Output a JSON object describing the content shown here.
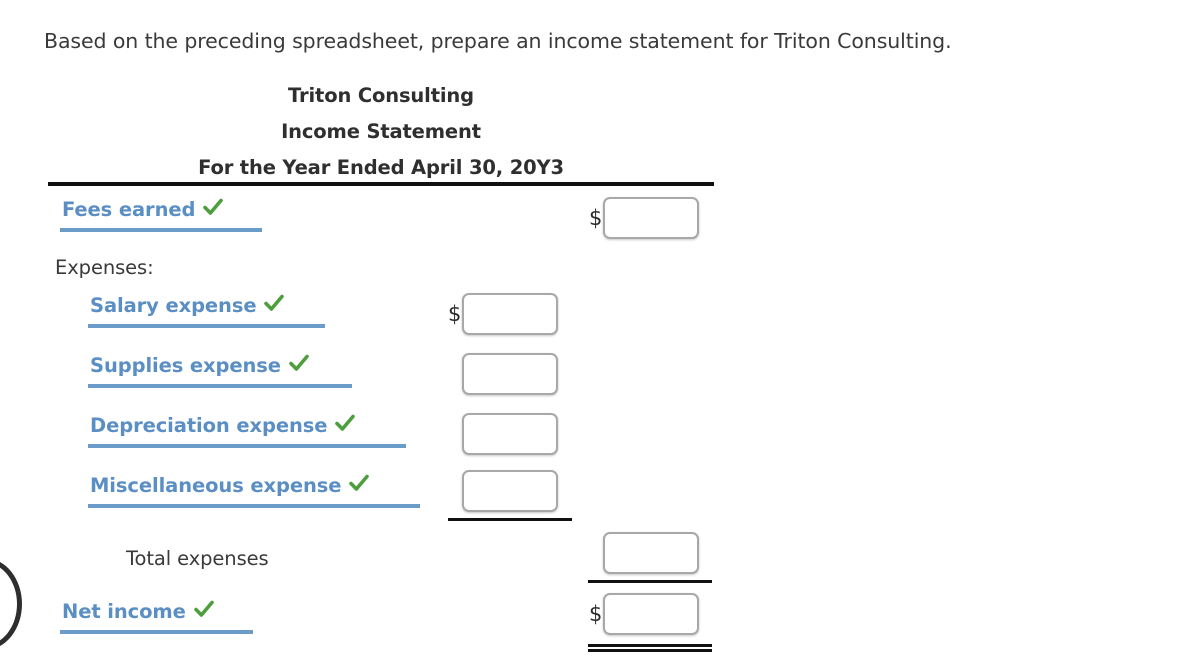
{
  "prompt": {
    "text": "Based on the preceding spreadsheet, prepare an income statement for Triton Consulting."
  },
  "statement": {
    "company": "Triton Consulting",
    "report": "Income Statement",
    "period": "For the Year Ended April 30, 20Y3",
    "section_label": "Expenses:",
    "total_label": "Total expenses",
    "currency_symbol": "$",
    "check_icon": "green-check-icon",
    "colors": {
      "label_blue": "#5b8fc4",
      "underline_blue": "#6b9bc9",
      "check_green": "#4e9e3e",
      "rule_black": "#111111",
      "text_dark": "#3a3a3a",
      "box_border": "#a8a8a8"
    },
    "rows": [
      {
        "label": "Fees earned",
        "style": "blue",
        "checked": true,
        "column": "right",
        "dollar": true,
        "value": "",
        "placeholder": ""
      },
      {
        "label": "Salary expense",
        "style": "blue",
        "checked": true,
        "column": "middle",
        "dollar": true,
        "value": "",
        "placeholder": ""
      },
      {
        "label": "Supplies expense",
        "style": "blue",
        "checked": true,
        "column": "middle",
        "dollar": false,
        "value": "",
        "placeholder": ""
      },
      {
        "label": "Depreciation expense",
        "style": "blue",
        "checked": true,
        "column": "middle",
        "dollar": false,
        "value": "",
        "placeholder": ""
      },
      {
        "label": "Miscellaneous expense",
        "style": "blue",
        "checked": true,
        "column": "middle",
        "dollar": false,
        "value": "",
        "placeholder": ""
      },
      {
        "label": "Total expenses",
        "style": "plain",
        "checked": false,
        "column": "right",
        "dollar": false,
        "value": "",
        "placeholder": ""
      },
      {
        "label": "Net income",
        "style": "blue",
        "checked": true,
        "column": "right",
        "dollar": true,
        "value": "",
        "placeholder": ""
      }
    ]
  }
}
